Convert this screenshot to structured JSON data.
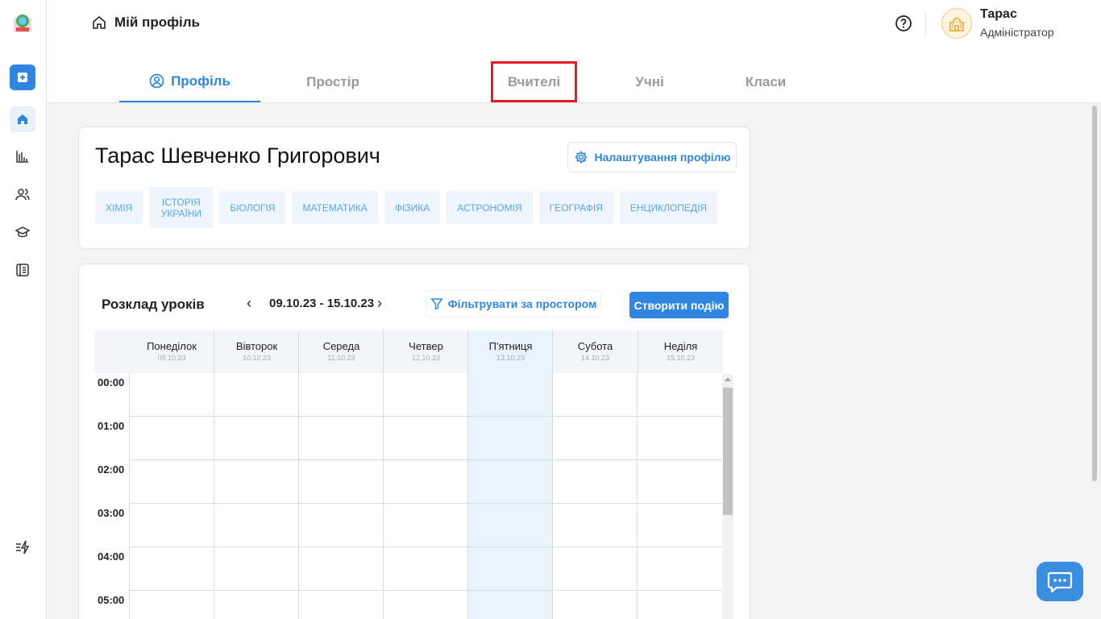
{
  "header": {
    "title": "Мій профіль",
    "user_name": "Тарас",
    "user_role": "Адміністратор"
  },
  "tabs": [
    {
      "label": "Профіль",
      "active": true
    },
    {
      "label": "Простір",
      "active": false
    },
    {
      "label": "Вчителі",
      "active": false,
      "highlighted": true
    },
    {
      "label": "Учні",
      "active": false
    },
    {
      "label": "Класи",
      "active": false
    }
  ],
  "profile": {
    "full_name": "Тарас Шевченко Григорович",
    "settings_label": "Налаштування профілю",
    "subjects": [
      "ХІМІЯ",
      "ІСТОРІЯ УКРАЇНИ",
      "БІОЛОГІЯ",
      "МАТЕМАТИКА",
      "ФІЗИКА",
      "АСТРОНОМІЯ",
      "ГЕОГРАФІЯ",
      "ЕНЦИКЛОПЕДІЯ"
    ]
  },
  "schedule": {
    "title": "Розклад уроків",
    "date_range": "09.10.23 - 15.10.23",
    "filter_label": "Фільтрувати за простором",
    "create_label": "Створити подію",
    "days": [
      {
        "name": "Понеділок",
        "date": "09.10.23"
      },
      {
        "name": "Вівторок",
        "date": "10.10.23"
      },
      {
        "name": "Середа",
        "date": "11.10.23"
      },
      {
        "name": "Четвер",
        "date": "12.10.23"
      },
      {
        "name": "П'ятниця",
        "date": "13.10.23",
        "today": true
      },
      {
        "name": "Субота",
        "date": "14.10.23"
      },
      {
        "name": "Неділя",
        "date": "15.10.23"
      }
    ],
    "times": [
      "00:00",
      "01:00",
      "02:00",
      "03:00",
      "04:00",
      "05:00"
    ]
  },
  "colors": {
    "accent": "#2f86e0",
    "today_column": "#e8f3fd",
    "highlight_box": "#e01b24"
  },
  "icons": {
    "sidebar": [
      "add-icon",
      "home-icon",
      "stats-icon",
      "users-icon",
      "graduation-cap-icon",
      "journal-icon",
      "flash-list-icon"
    ],
    "header": [
      "home-icon",
      "help-icon",
      "school-icon"
    ],
    "profile": [
      "gear-icon",
      "user-circle-icon"
    ],
    "schedule": [
      "chevron-left-icon",
      "chevron-right-icon",
      "filter-icon"
    ],
    "floating": "chat-icon"
  }
}
